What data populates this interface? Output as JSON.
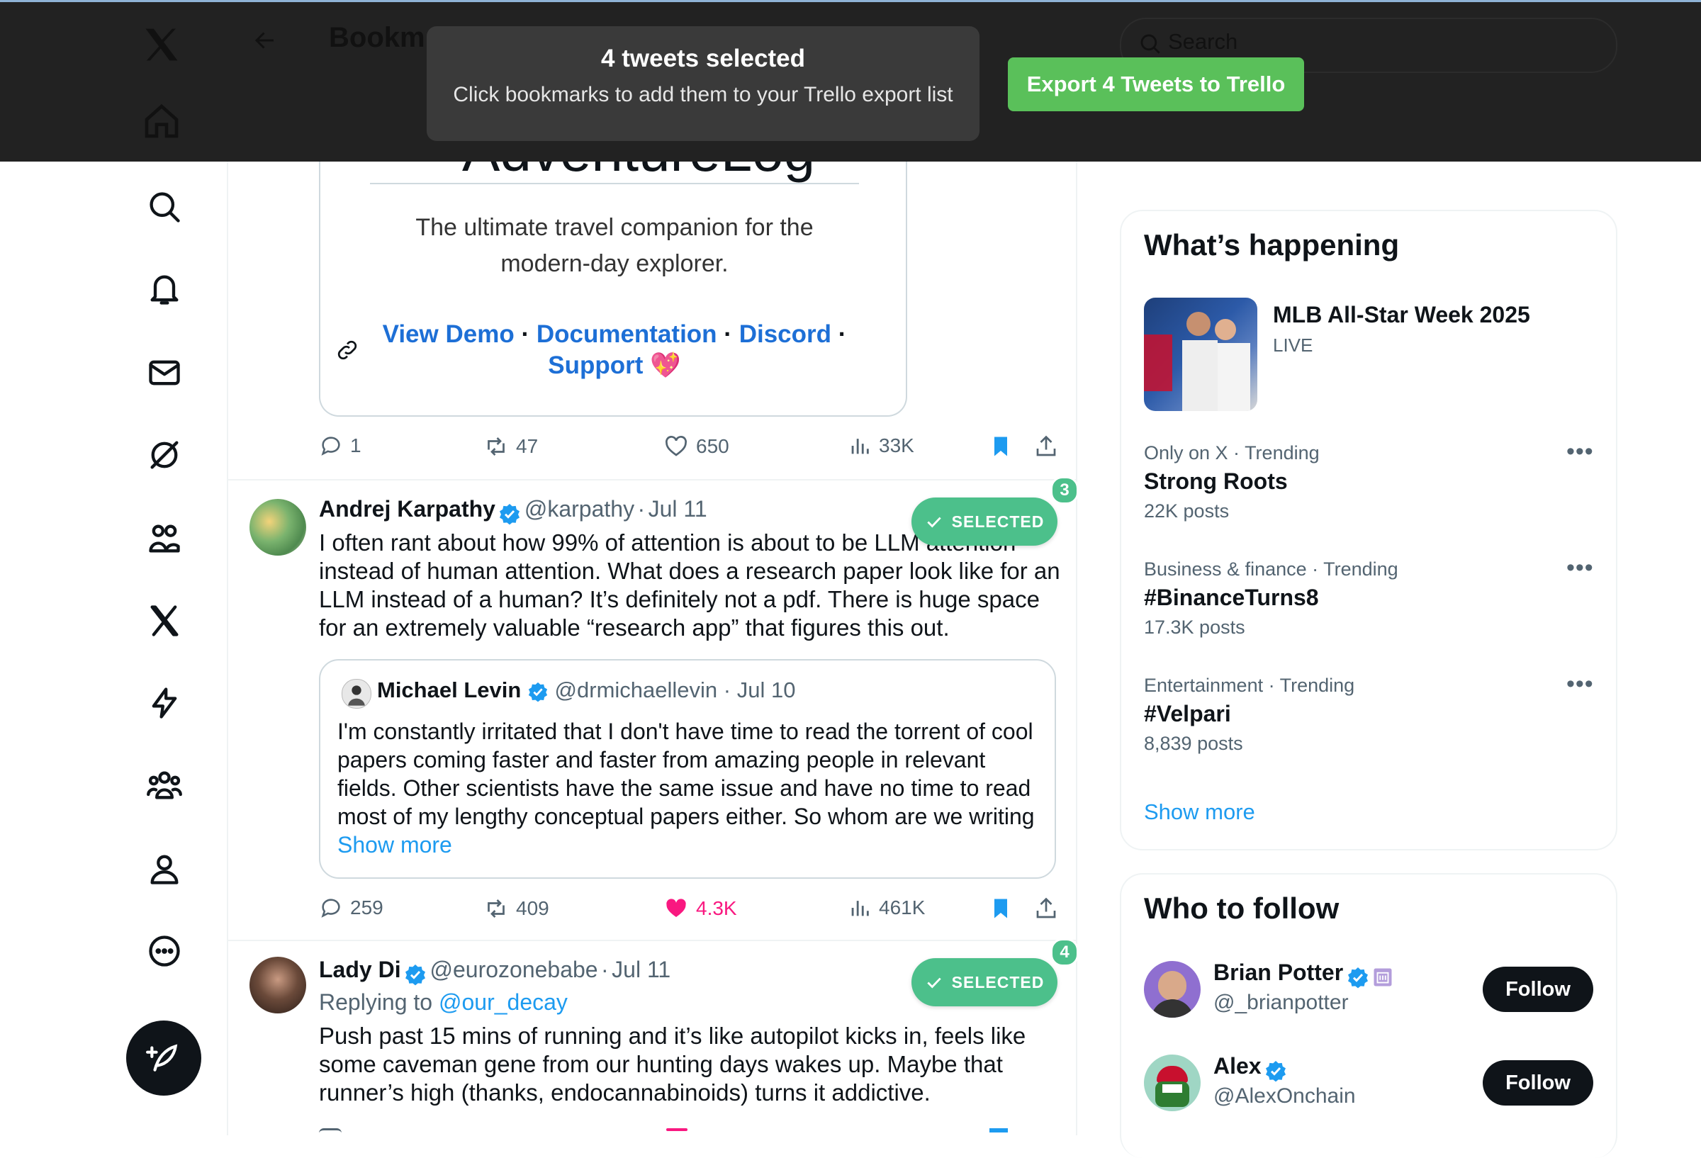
{
  "overlay": {
    "toast_title": "4 tweets selected",
    "toast_subtitle": "Click bookmarks to add them to your Trello export list",
    "export_button": "Export 4 Tweets to Trello"
  },
  "header": {
    "title_partial": "Bookm",
    "search_placeholder": "Search"
  },
  "card_preview": {
    "title_partial": "AdventureLog",
    "description": "The ultimate travel companion for the modern-day explorer.",
    "link_view_demo": "View Demo",
    "link_documentation": "Documentation",
    "link_discord": "Discord",
    "link_support": "Support",
    "sep": "·",
    "heart_emoji": "💖"
  },
  "tweet0_actions": {
    "replies": "1",
    "retweets": "47",
    "likes": "650",
    "views": "33K"
  },
  "tweets": [
    {
      "name": "Andrej Karpathy",
      "handle": "@karpathy",
      "dot": "·",
      "date": "Jul 11",
      "text": "I often rant about how 99% of attention is about to be LLM attention instead of human attention. What does a research paper look like for an LLM instead of a human? It’s definitely not a pdf. There is huge space for an extremely valuable “research app” that figures this out.",
      "selected_label": "SELECTED",
      "selected_number": "3",
      "quote": {
        "name": "Michael Levin",
        "handle": "@drmichaellevin",
        "dot": "·",
        "date": "Jul 10",
        "text": "I'm constantly irritated that I don't have time to read the torrent of cool papers coming faster and faster from amazing people in relevant fields. Other scientists have the same issue and have no time to read most of my lengthy conceptual papers either.  So whom are we writing",
        "show_more": "Show more"
      },
      "actions": {
        "replies": "259",
        "retweets": "409",
        "likes": "4.3K",
        "views": "461K"
      }
    },
    {
      "name": "Lady Di",
      "handle": "@eurozonebabe",
      "dot": "·",
      "date": "Jul 11",
      "replying_prefix": "Replying to",
      "replying_to": "@our_decay",
      "text": "Push past 15 mins of running and it’s like autopilot kicks in, feels like some caveman gene from our hunting days wakes up. Maybe that runner’s high (thanks, endocannabinoids) turns it addictive.",
      "selected_label": "SELECTED",
      "selected_number": "4"
    }
  ],
  "whats_happening": {
    "title": "What’s happening",
    "event": {
      "name": "MLB All-Star Week 2025",
      "status": "LIVE"
    },
    "trends": [
      {
        "category": "Only on X · Trending",
        "name": "Strong Roots",
        "posts": "22K posts"
      },
      {
        "category": "Business & finance · Trending",
        "name": "#BinanceTurns8",
        "posts": "17.3K posts"
      },
      {
        "category": "Entertainment · Trending",
        "name": "#Velpari",
        "posts": "8,839 posts"
      }
    ],
    "show_more": "Show more"
  },
  "who_to_follow": {
    "title": "Who to follow",
    "users": [
      {
        "name": "Brian Potter",
        "handle": "@_brianpotter",
        "button": "Follow"
      },
      {
        "name": "Alex",
        "handle": "@AlexOnchain",
        "button": "Follow"
      }
    ]
  },
  "colors": {
    "accent_blue": "#1d9bf0",
    "link_blue": "#1d6fd6",
    "selected_green": "#4cc08b",
    "export_green": "#5ac05a",
    "like_pink": "#f91880",
    "overlay_dark": "#222222"
  }
}
